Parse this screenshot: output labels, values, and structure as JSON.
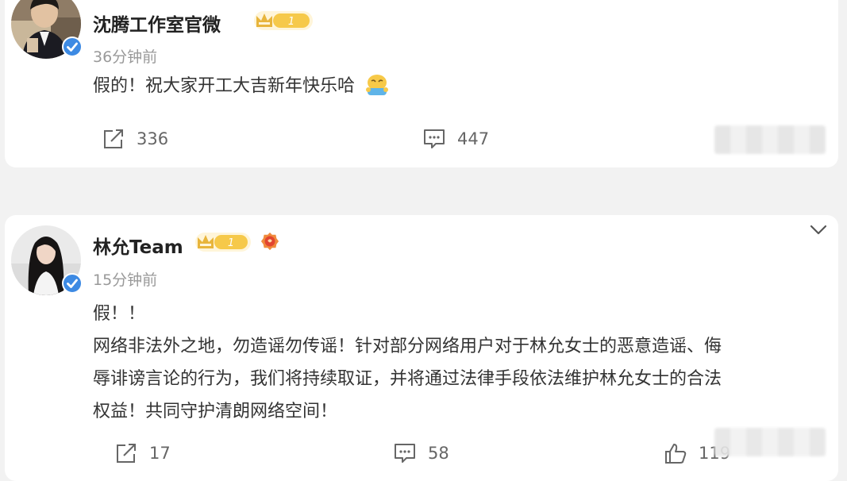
{
  "posts": [
    {
      "author": "沈腾工作室官微",
      "time": "36分钟前",
      "text_lines": [
        "假的！祝大家开工大吉新年快乐哈"
      ],
      "reposts": "336",
      "comments": "447",
      "level": "1",
      "avatar_icon": "man-photo-avatar",
      "emoji_icon": "bowing-emoji-icon"
    },
    {
      "author": "林允Team",
      "time": "15分钟前",
      "text_lines": [
        "假！！",
        "网络非法外之地，勿造谣勿传谣！针对部分网络用户对于林允女士的恶意造谣、侮",
        "辱诽谤言论的行为，我们将持续取证，并将通过法律手段依法维护林允女士的合法",
        "权益！共同守护清朗网络空间！"
      ],
      "reposts": "17",
      "comments": "58",
      "likes": "119",
      "level": "1",
      "avatar_icon": "woman-photo-avatar",
      "fan_badge_icon": "fan-badge-icon"
    }
  ],
  "colors": {
    "verified_blue": "#3d8ae3",
    "badge_gold": "#e8b53c",
    "name": "#222222",
    "meta_gray": "#999999"
  }
}
